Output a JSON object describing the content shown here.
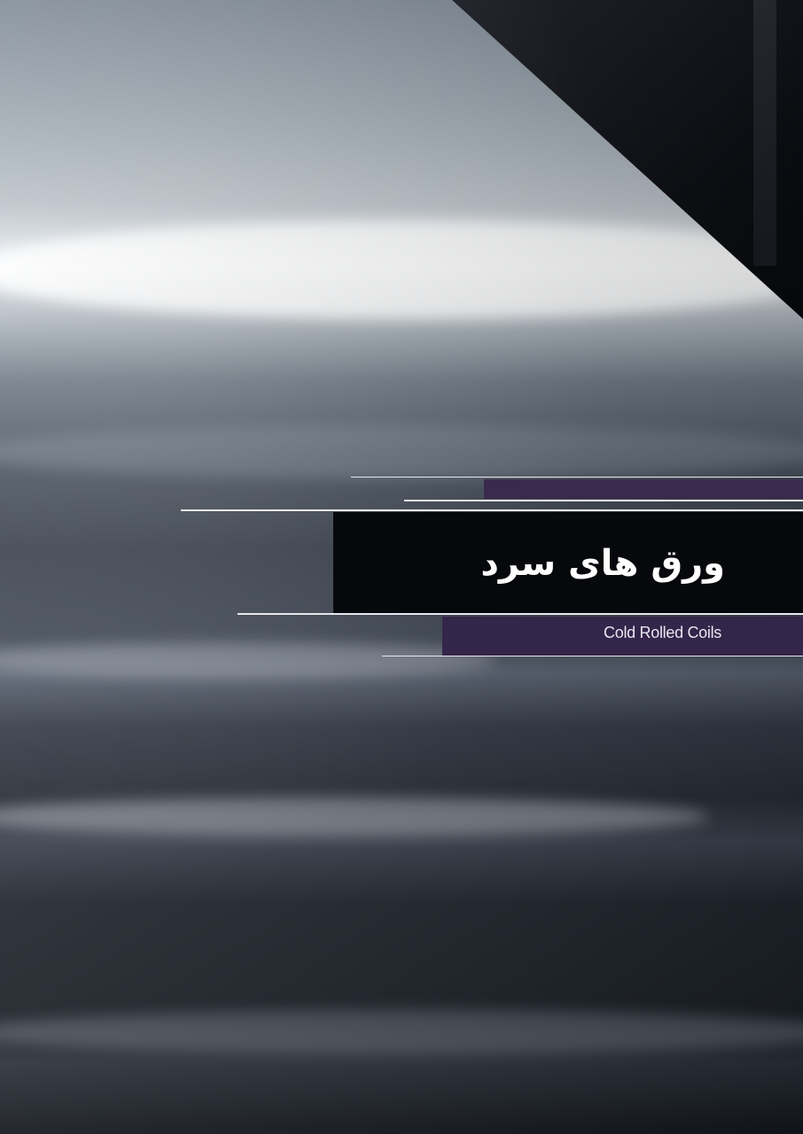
{
  "cover": {
    "title": "ورق های سرد",
    "subtitle": "Cold Rolled Coils"
  },
  "colors": {
    "title_band": "#07080c",
    "accent_purple": "#3a2a4e",
    "rule_lines": "#e8e8ec"
  },
  "background_image": "steel-sheet-photo"
}
